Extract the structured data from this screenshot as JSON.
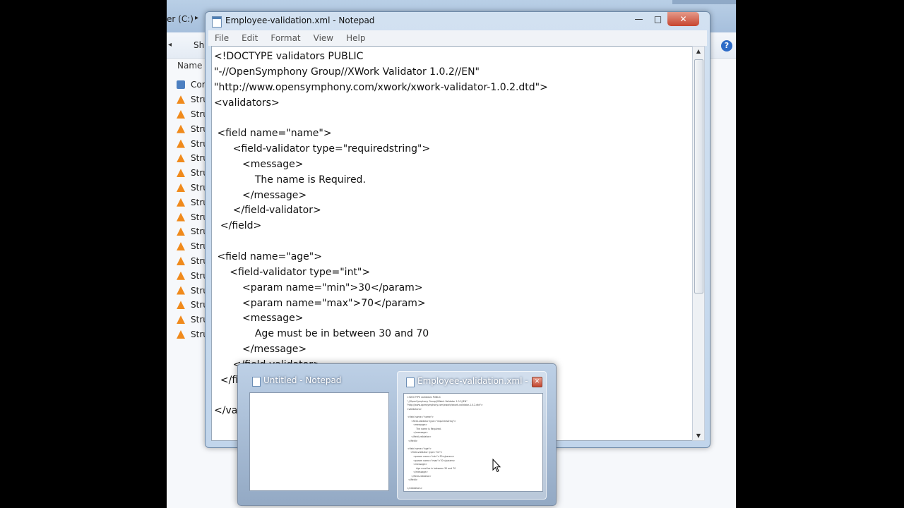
{
  "explorer": {
    "path": "er (C:)",
    "share_label": "Sha",
    "column_header": "Name",
    "items": [
      {
        "label": "Cor",
        "icon": "word-doc-icon"
      },
      {
        "label": "Stru",
        "icon": "vlc-cone-icon"
      },
      {
        "label": "Stru",
        "icon": "vlc-cone-icon"
      },
      {
        "label": "Stru",
        "icon": "vlc-cone-icon"
      },
      {
        "label": "Stru",
        "icon": "vlc-cone-icon"
      },
      {
        "label": "Stru",
        "icon": "vlc-cone-icon"
      },
      {
        "label": "Stru",
        "icon": "vlc-cone-icon"
      },
      {
        "label": "Stru",
        "icon": "vlc-cone-icon"
      },
      {
        "label": "Stru",
        "icon": "vlc-cone-icon"
      },
      {
        "label": "Stru",
        "icon": "vlc-cone-icon"
      },
      {
        "label": "Stru",
        "icon": "vlc-cone-icon"
      },
      {
        "label": "Stru",
        "icon": "vlc-cone-icon"
      },
      {
        "label": "Stru",
        "icon": "vlc-cone-icon"
      },
      {
        "label": "Stru",
        "icon": "vlc-cone-icon"
      },
      {
        "label": "Stru",
        "icon": "vlc-cone-icon"
      },
      {
        "label": "Stru",
        "icon": "vlc-cone-icon"
      },
      {
        "label": "Stru",
        "icon": "vlc-cone-icon"
      },
      {
        "label": "Stru",
        "icon": "vlc-cone-icon"
      }
    ],
    "help_glyph": "?"
  },
  "notepad": {
    "title": "Employee-validation.xml - Notepad",
    "controls": {
      "minimize": "—",
      "maximize": "□",
      "close": "✕"
    },
    "menu": [
      "File",
      "Edit",
      "Format",
      "View",
      "Help"
    ],
    "content_lines": [
      "<!DOCTYPE validators PUBLIC",
      "\"-//OpenSymphony Group//XWork Validator 1.0.2//EN\"",
      "\"http://www.opensymphony.com/xwork/xwork-validator-1.0.2.dtd\">",
      "<validators>",
      "",
      " <field name=\"name\">",
      "      <field-validator type=\"requiredstring\">",
      "         <message>",
      "             The name is Required.",
      "         </message>",
      "      </field-validator>",
      "  </field>",
      "",
      " <field name=\"age\">",
      "     <field-validator type=\"int\">",
      "         <param name=\"min\">30</param>",
      "         <param name=\"max\">70</param>",
      "         <message>",
      "             Age must be in between 30 and 70",
      "         </message>",
      "      </field-validator>",
      "  </field>",
      "",
      "</validators>"
    ]
  },
  "taskbar_popup": {
    "thumbnails": [
      {
        "title": "Untitled - Notepad"
      },
      {
        "title": "Employee-validation.xml - ...",
        "close_glyph": "✕"
      }
    ]
  }
}
